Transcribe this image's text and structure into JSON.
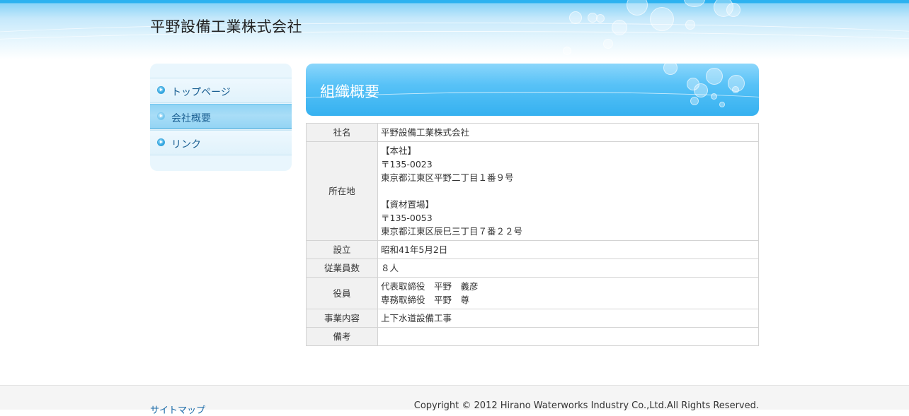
{
  "header": {
    "site_title": "平野設備工業株式会社"
  },
  "sidebar": {
    "items": [
      {
        "label": "トップページ",
        "active": false
      },
      {
        "label": "会社概要",
        "active": true
      },
      {
        "label": "リンク",
        "active": false
      }
    ]
  },
  "main": {
    "heading": "組織概要",
    "table": [
      {
        "label": "社名",
        "lines": [
          "平野設備工業株式会社"
        ]
      },
      {
        "label": "所在地",
        "lines": [
          "【本社】",
          "〒135-0023",
          "東京都江東区平野二丁目１番９号",
          "",
          "【資材置場】",
          "〒135-0053",
          "東京都江東区辰巳三丁目７番２２号"
        ]
      },
      {
        "label": "設立",
        "lines": [
          "昭和41年5月2日"
        ]
      },
      {
        "label": "従業員数",
        "lines": [
          "８人"
        ]
      },
      {
        "label": "役員",
        "lines": [
          "代表取締役　平野　義彦",
          "専務取締役　平野　尊"
        ]
      },
      {
        "label": "事業内容",
        "lines": [
          "上下水道設備工事"
        ]
      },
      {
        "label": "備考",
        "lines": [
          ""
        ]
      }
    ]
  },
  "footer": {
    "sitemap": "サイトマップ",
    "copyright": "Copyright © 2012 Hirano Waterworks Industry Co.,Ltd.All Rights Reserved."
  },
  "colors": {
    "accent": "#35b1f0",
    "nav_text": "#1a5f92",
    "link": "#1a6aa8"
  }
}
